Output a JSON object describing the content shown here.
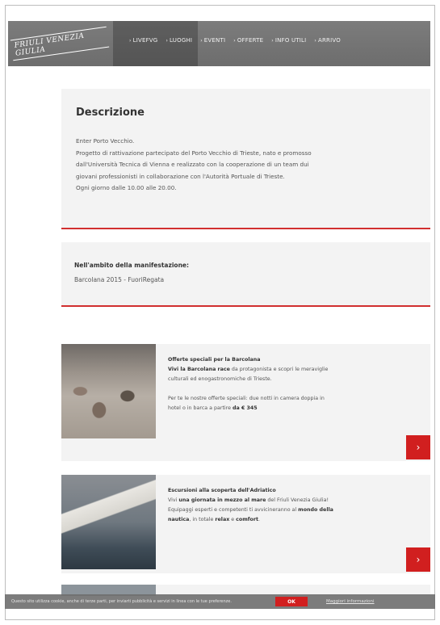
{
  "header": {
    "logo_text": "FRIULI VENEZIA GIULIA",
    "nav": [
      {
        "label": "LIVEFVG"
      },
      {
        "label": "LUOGHI"
      },
      {
        "label": "EVENTI"
      },
      {
        "label": "OFFERTE"
      },
      {
        "label": "INFO UTILI"
      },
      {
        "label": "ARRIVO"
      }
    ]
  },
  "description": {
    "title": "Descrizione",
    "lines": [
      "Enter Porto Vecchio.",
      "Progetto di rattivazione partecipato del Porto Vecchio di Trieste, nato e promosso",
      "dall'Università Tecnica di Vienna e realizzato con la cooperazione di un team dui",
      "giovani professionisti in collaborazione con l'Autorità Portuale di Trieste.",
      "Ogni giorno dalle 10.00 alle 20.00."
    ]
  },
  "ambito": {
    "label": "Nell'ambito della manifestazione:",
    "value": "Barcolana 2015 - FuoriRegata"
  },
  "promos": [
    {
      "title": "Offerte speciali per la Barcolana",
      "line1_bold": "Vivi la Barcolana race",
      "line1_rest": " da protagonista e scopri le meraviglie",
      "line2": "culturali ed enogastronomiche di Trieste.",
      "line3": "Per te le nostre offerte speciali: due notti in camera doppia in",
      "line4_pre": "hotel o in barca a partire ",
      "line4_bold": "da € 345",
      "button_icon": "chevron-right-icon"
    },
    {
      "title": "Escursioni alla scoperta dell'Adriatico",
      "line1_pre": "Vivi ",
      "line1_bold": "una giornata in mezzo al mare",
      "line1_rest": " del Friuli Venezia Giulia!",
      "line2_pre": "Equipaggi esperti e competenti ti avvicineranno al ",
      "line2_bold": "mondo della",
      "line3_bold": "nautica",
      "line3_mid": ", in totale ",
      "line3_bold2": "relax",
      "line3_mid2": " e ",
      "line3_bold3": "comfort",
      "line3_end": ".",
      "button_icon": "chevron-right-icon"
    }
  ],
  "cookie": {
    "text": "Questo sito utilizza cookie, anche di terze parti, per inviarti pubblicità e servizi in linea con le tue preferenze.",
    "ok_label": "OK",
    "more_label": "Maggiori informazioni"
  },
  "colors": {
    "accent": "#d11f1f",
    "header_bg": "#757575",
    "card_bg": "#f3f3f3"
  }
}
